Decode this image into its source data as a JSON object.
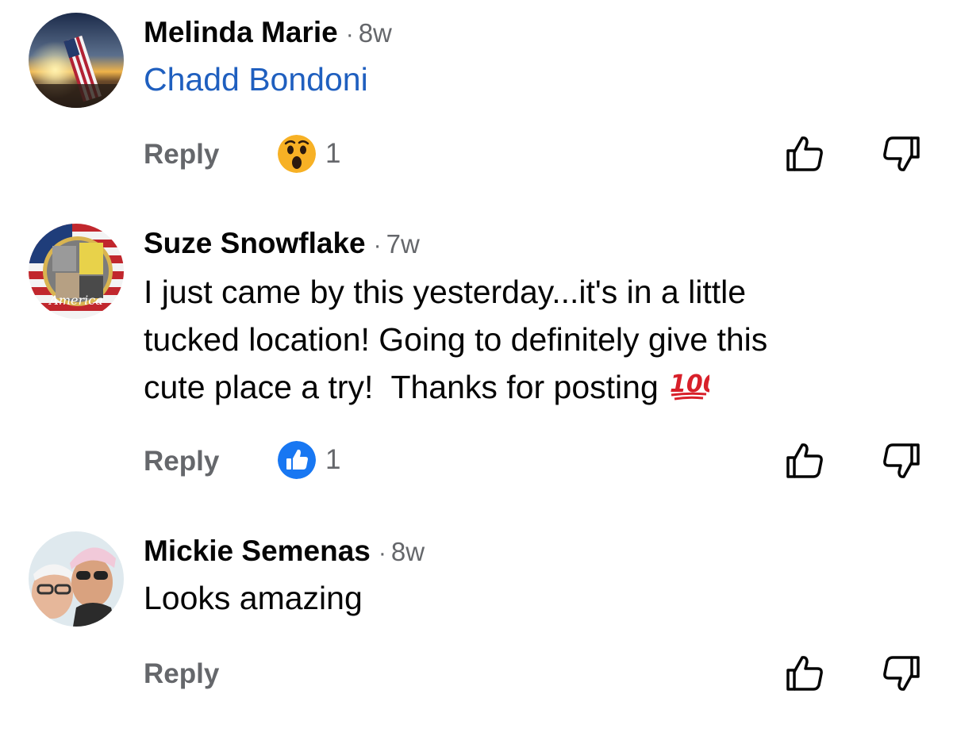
{
  "comments": [
    {
      "author": "Melinda Marie",
      "separator": "·",
      "time": "8w",
      "mention": "Chadd Bondoni",
      "reply_label": "Reply",
      "reaction": {
        "icon": "wow-reaction-icon",
        "count": "1"
      }
    },
    {
      "author": "Suze Snowflake",
      "separator": "·",
      "time": "7w",
      "text_lines": [
        "I just came by this yesterday...it's in a little",
        "tucked location!  Going to definitely give this",
        "cute place a try!  Thanks for posting"
      ],
      "emoji": "hundred-points-icon",
      "reply_label": "Reply",
      "reaction": {
        "icon": "like-reaction-icon",
        "count": "1"
      }
    },
    {
      "author": "Mickie Semenas",
      "separator": "·",
      "time": "8w",
      "text": "Looks amazing",
      "reply_label": "Reply"
    }
  ],
  "colors": {
    "author": "#050505",
    "meta": "#65676b",
    "mention": "#1f5fbf",
    "like_blue": "#1877f2",
    "wow_yellow": "#f7b125"
  }
}
